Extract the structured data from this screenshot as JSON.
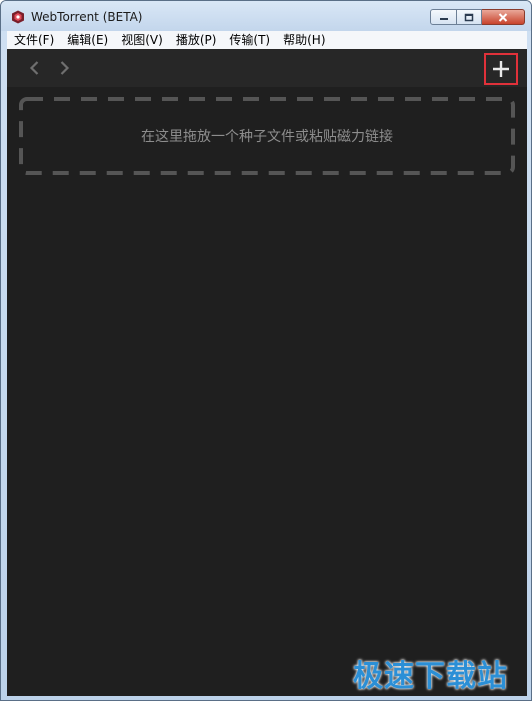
{
  "window": {
    "title": "WebTorrent (BETA)",
    "app_icon": "webtorrent-logo-icon",
    "controls": [
      "minimize-icon",
      "maximize-icon",
      "close-icon"
    ]
  },
  "menubar": {
    "items": [
      {
        "label": "文件(F)"
      },
      {
        "label": "编辑(E)"
      },
      {
        "label": "视图(V)"
      },
      {
        "label": "播放(P)"
      },
      {
        "label": "传输(T)"
      },
      {
        "label": "帮助(H)"
      }
    ]
  },
  "toolbar": {
    "back_icon": "chevron-left-icon",
    "forward_icon": "chevron-right-icon",
    "add_icon": "plus-icon",
    "add_highlight_color": "#e0313a"
  },
  "drop_zone": {
    "text": "在这里拖放一个种子文件或粘贴磁力链接"
  },
  "watermark": {
    "text": "极速下载站"
  },
  "colors": {
    "app_background": "#1f1f1f",
    "toolbar_background": "#272727",
    "drop_border": "#555555",
    "drop_text": "#8d8d8d",
    "watermark": "#2b8fd6"
  }
}
